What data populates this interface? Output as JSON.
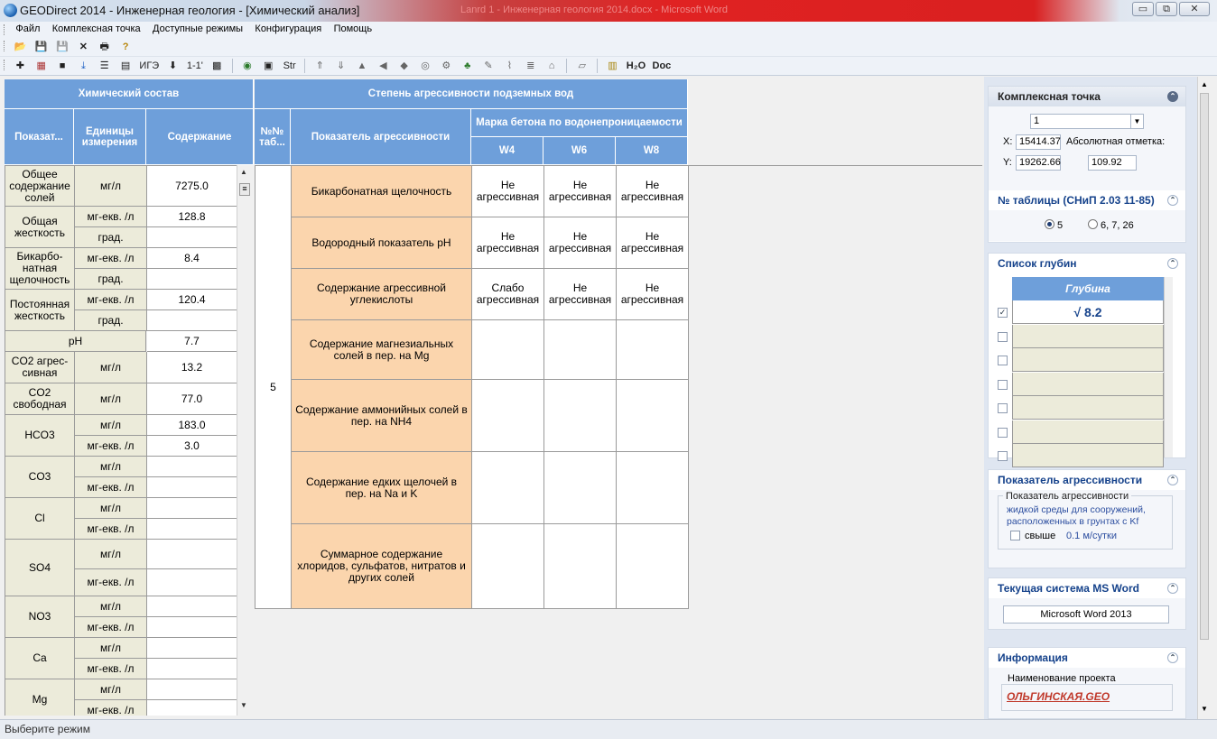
{
  "window": {
    "title": "GEODirect 2014 - Инженерная геология - [Химический анализ]",
    "ghost_title": "Lanrd 1 - Инженерная геология 2014.docx - Microsoft Word",
    "controls": {
      "minimize": "▭",
      "restore": "⧉",
      "close": "✕"
    }
  },
  "menu": [
    "Файл",
    "Комплексная точка",
    "Доступные режимы",
    "Конфигурация",
    "Помощь"
  ],
  "toolbar1": [
    "📂",
    "💾",
    "💾",
    "✕",
    "🖶",
    "?"
  ],
  "toolbar2": {
    "igs": "ИГЭ",
    "one_one": "1-1'",
    "str": "Str",
    "h2o": "H₂O",
    "doc": "Doc"
  },
  "left_table": {
    "group_header": "Химический состав",
    "col_indicator": "Показат...",
    "col_units": "Единицы измерения",
    "col_content": "Содержание",
    "rows": [
      {
        "label": "Общее содержание солей",
        "units": [
          "мг/л"
        ],
        "values": [
          "7275.0"
        ]
      },
      {
        "label": "Общая жесткость",
        "units": [
          "мг-екв. /л",
          "град."
        ],
        "values": [
          "128.8",
          ""
        ]
      },
      {
        "label": "Бикарбо-натная щелочность",
        "units": [
          "мг-екв. /л",
          "град."
        ],
        "values": [
          "8.4",
          ""
        ]
      },
      {
        "label": "Постоянная жесткость",
        "units": [
          "мг-екв. /л",
          "град."
        ],
        "values": [
          "120.4",
          ""
        ]
      },
      {
        "label": "pH",
        "units": [],
        "values": [
          "7.7"
        ]
      },
      {
        "label": "CO2 агрес-сивная",
        "units": [
          "мг/л"
        ],
        "values": [
          "13.2"
        ]
      },
      {
        "label": "CO2 свободная",
        "units": [
          "мг/л"
        ],
        "values": [
          "77.0"
        ]
      },
      {
        "label": "HCO3",
        "units": [
          "мг/л",
          "мг-екв. /л"
        ],
        "values": [
          "183.0",
          "3.0"
        ]
      },
      {
        "label": "CO3",
        "units": [
          "мг/л",
          "мг-екв. /л"
        ],
        "values": [
          "",
          ""
        ]
      },
      {
        "label": "Cl",
        "units": [
          "мг/л",
          "мг-екв. /л"
        ],
        "values": [
          "",
          ""
        ]
      },
      {
        "label": "SO4",
        "units": [
          "мг/л",
          "мг-екв. /л"
        ],
        "values": [
          "",
          ""
        ]
      },
      {
        "label": "NO3",
        "units": [
          "мг/л",
          "мг-екв. /л"
        ],
        "values": [
          "",
          ""
        ]
      },
      {
        "label": "Ca",
        "units": [
          "мг/л",
          "мг-екв. /л"
        ],
        "values": [
          "",
          ""
        ]
      },
      {
        "label": "Mg",
        "units": [
          "мг/л",
          "мг-екв. /л"
        ],
        "values": [
          "",
          ""
        ]
      }
    ]
  },
  "right_table": {
    "group_header": "Степень агрессивности подземных вод",
    "col_table_no": "№№ таб...",
    "col_indicator": "Показатель агрессивности",
    "col_concrete": "Марка бетона по водонепроницаемости",
    "grades": [
      "W4",
      "W6",
      "W8"
    ],
    "table_no": "5",
    "rows": [
      {
        "indicator": "Бикарбонатная щелочность",
        "w": [
          "Не агрессивная",
          "Не агрессивная",
          "Не агрессивная"
        ]
      },
      {
        "indicator": "Водородный показатель pH",
        "w": [
          "Не агрессивная",
          "Не агрессивная",
          "Не агрессивная"
        ]
      },
      {
        "indicator": "Содержание агрессивной углекислоты",
        "w": [
          "Слабо агрессивная",
          "Не агрессивная",
          "Не агрессивная"
        ]
      },
      {
        "indicator": "Содержание магнезиальных солей в пер. на Mg",
        "w": [
          "",
          "",
          ""
        ]
      },
      {
        "indicator": "Содержание аммонийных солей в пер. на NH4",
        "w": [
          "",
          "",
          ""
        ]
      },
      {
        "indicator": "Содержание едких щелочей в пер. на Na и K",
        "w": [
          "",
          "",
          ""
        ]
      },
      {
        "indicator": "Суммарное содержание хлоридов, сульфатов, нитратов и других солей",
        "w": [
          "",
          "",
          ""
        ]
      }
    ]
  },
  "panel": {
    "complex_point": {
      "title": "Комплексная точка",
      "selected": "1",
      "x_label": "X:",
      "x_value": "15414.37",
      "y_label": "Y:",
      "y_value": "19262.66",
      "abs_label": "Абсолютная отметка:",
      "abs_value": "109.92"
    },
    "snip": {
      "title": "№ таблицы (СНиП 2.03 11-85)",
      "option1": "5",
      "option2": "6, 7, 26"
    },
    "depths": {
      "title": "Список глубин",
      "col": "Глубина",
      "value": "√ 8.2"
    },
    "aggr": {
      "title": "Показатель агрессивности",
      "legend": "Показатель агрессивности",
      "desc": "жидкой среды для сооружений, расположенных в грунтах с Kf",
      "check_label": "свыше",
      "rate": "0.1 м/сутки"
    },
    "word": {
      "title": "Текущая система MS Word",
      "value": "Microsoft Word 2013"
    },
    "info": {
      "title": "Информация",
      "label": "Наименование проекта",
      "project": "ОЛЬГИНСКАЯ.GEO"
    }
  },
  "status": "Выберите режим",
  "colors": {
    "header_blue": "#6e9fda",
    "label_bg": "#ecebda",
    "indicator_bg": "#fbd5ad",
    "panel_title": "#15428b",
    "project_link": "#c0392b"
  }
}
